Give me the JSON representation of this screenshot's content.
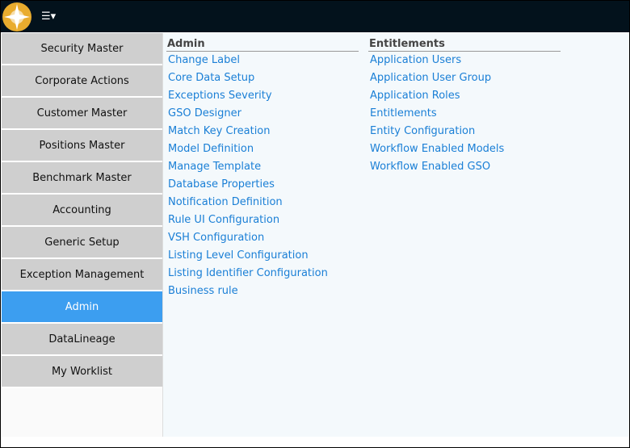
{
  "header": {
    "menu_icon": "☰▾"
  },
  "sidebar": {
    "items": [
      {
        "label": "Security Master"
      },
      {
        "label": "Corporate Actions"
      },
      {
        "label": "Customer Master"
      },
      {
        "label": "Positions Master"
      },
      {
        "label": "Benchmark Master"
      },
      {
        "label": "Accounting"
      },
      {
        "label": "Generic Setup"
      },
      {
        "label": "Exception Management"
      },
      {
        "label": "Admin",
        "active": true
      },
      {
        "label": "DataLineage"
      },
      {
        "label": "My Worklist"
      }
    ]
  },
  "admin": {
    "title": "Admin",
    "links": [
      "Change Label",
      "Core Data Setup",
      "Exceptions Severity",
      "GSO Designer",
      "Match Key Creation",
      "Model Definition",
      "Manage Template",
      "Database Properties",
      "Notification Definition",
      "Rule UI Configuration",
      "VSH Configuration",
      "Listing Level Configuration",
      "Listing Identifier Configuration",
      "Business rule"
    ]
  },
  "entitlements": {
    "title": "Entitlements",
    "links": [
      "Application Users",
      "Application User Group",
      "Application Roles",
      "Entitlements",
      "Entity Configuration",
      "Workflow Enabled Models",
      "Workflow Enabled GSO"
    ]
  }
}
